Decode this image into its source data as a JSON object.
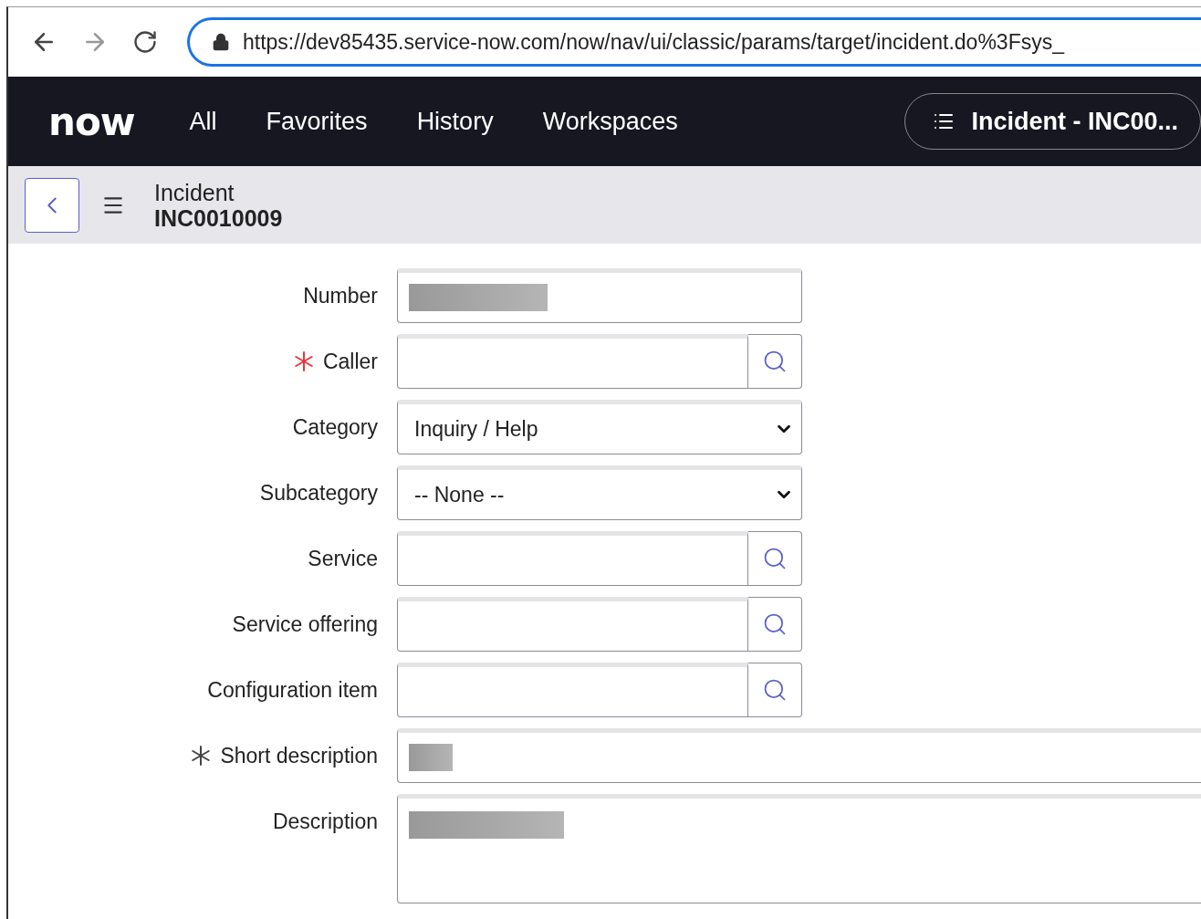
{
  "browser": {
    "url": "https://dev85435.service-now.com/now/nav/ui/classic/params/target/incident.do%3Fsys_"
  },
  "nav": {
    "logo": "now",
    "items": [
      {
        "label": "All"
      },
      {
        "label": "Favorites"
      },
      {
        "label": "History"
      },
      {
        "label": "Workspaces"
      }
    ],
    "context_tab": "Incident - INC00..."
  },
  "header": {
    "table": "Incident",
    "record": "INC0010009"
  },
  "fields": [
    {
      "label": "Number",
      "kind": "text",
      "required": false,
      "redacted": true
    },
    {
      "label": "Caller",
      "kind": "reference",
      "required": true,
      "satisfied": false
    },
    {
      "label": "Category",
      "kind": "select",
      "value": "Inquiry / Help"
    },
    {
      "label": "Subcategory",
      "kind": "select",
      "value": "-- None --"
    },
    {
      "label": "Service",
      "kind": "reference",
      "required": false
    },
    {
      "label": "Service offering",
      "kind": "reference",
      "required": false
    },
    {
      "label": "Configuration item",
      "kind": "reference",
      "required": false
    },
    {
      "label": "Short description",
      "kind": "wide",
      "required": true,
      "satisfied": true,
      "redacted": true
    },
    {
      "label": "Description",
      "kind": "textarea",
      "required": false,
      "redacted": true
    }
  ]
}
